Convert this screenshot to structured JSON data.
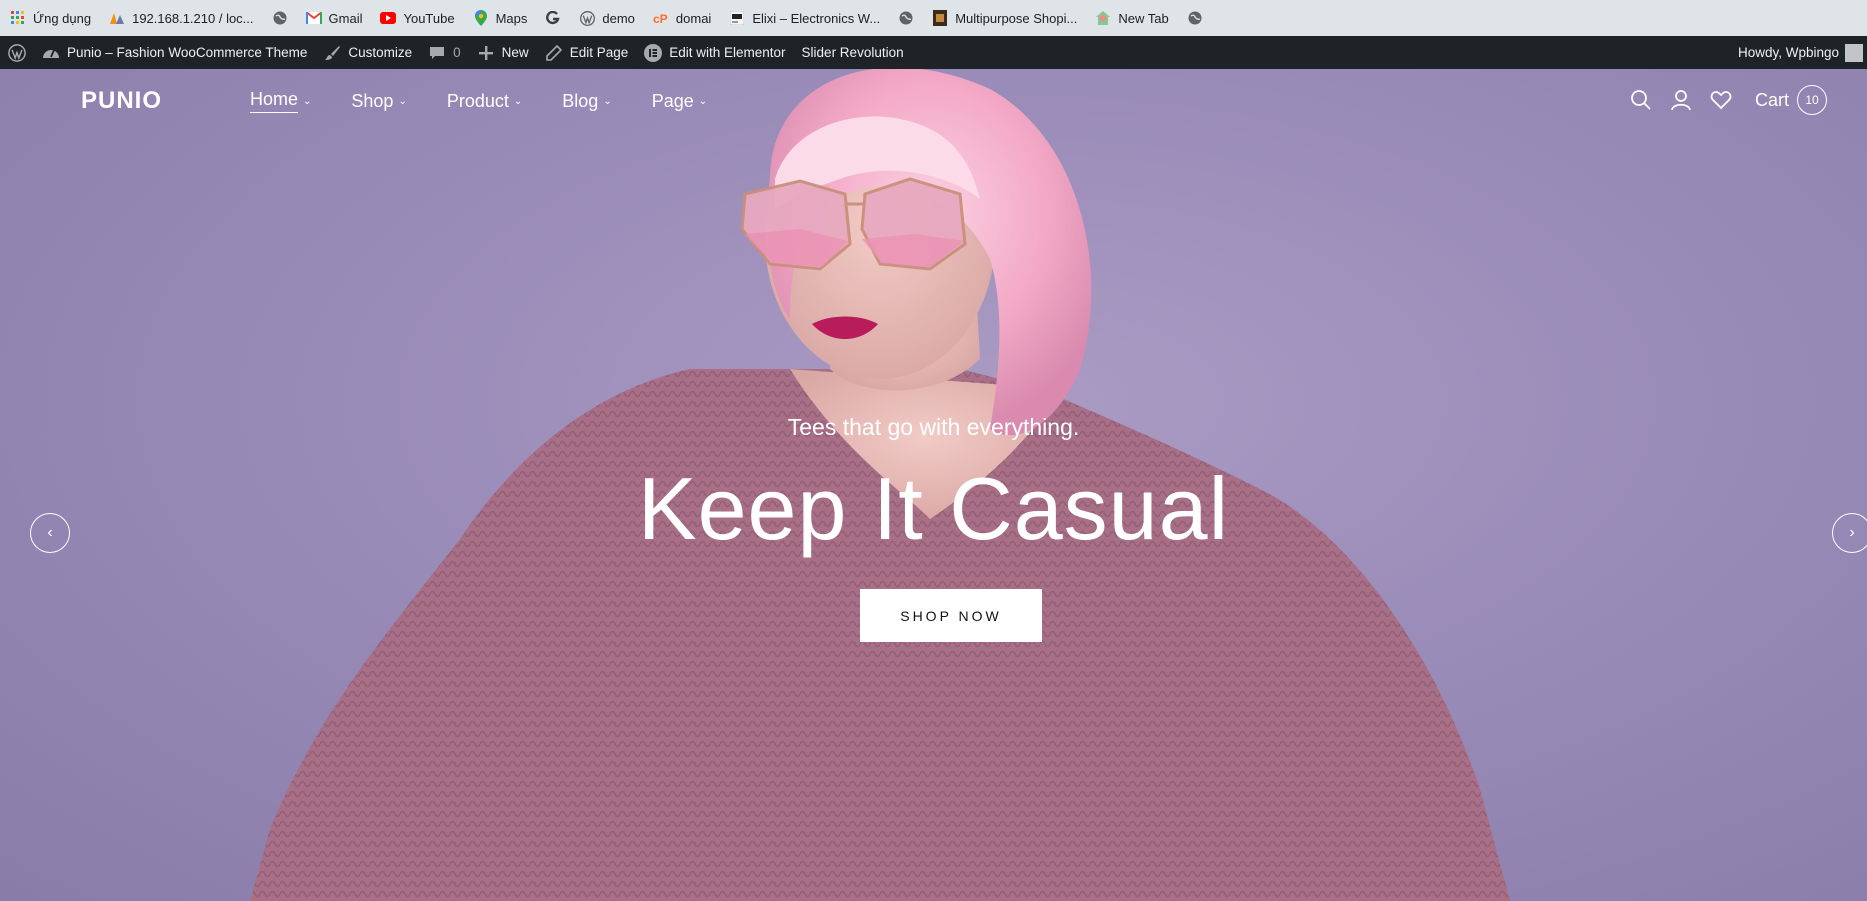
{
  "bookmarks": [
    {
      "label": "Ứng dụng",
      "icon": "apps-grid-icon"
    },
    {
      "label": "192.168.1.210 / loc...",
      "icon": "phpmyadmin-icon"
    },
    {
      "label": "",
      "icon": "globe-icon"
    },
    {
      "label": "Gmail",
      "icon": "gmail-icon"
    },
    {
      "label": "YouTube",
      "icon": "youtube-icon"
    },
    {
      "label": "Maps",
      "icon": "maps-pin-icon"
    },
    {
      "label": "",
      "icon": "opera-g-icon"
    },
    {
      "label": "demo",
      "icon": "wordpress-icon"
    },
    {
      "label": "domai",
      "icon": "cpanel-icon"
    },
    {
      "label": "Elixi – Electronics W...",
      "icon": "site-thumb-icon"
    },
    {
      "label": "",
      "icon": "globe-icon"
    },
    {
      "label": "Multipurpose Shopi...",
      "icon": "shop-thumb-icon"
    },
    {
      "label": "New Tab",
      "icon": "new-tab-icon"
    },
    {
      "label": "",
      "icon": "globe-icon"
    }
  ],
  "adminbar": {
    "site": "Punio – Fashion WooCommerce Theme",
    "customize": "Customize",
    "comments": "0",
    "new": "New",
    "edit_page": "Edit Page",
    "elementor": "Edit with Elementor",
    "slider": "Slider Revolution",
    "howdy": "Howdy, Wpbingo"
  },
  "header": {
    "logo": "PUNIO",
    "nav": [
      "Home",
      "Shop",
      "Product",
      "Blog",
      "Page"
    ],
    "cart_label": "Cart",
    "cart_count": "10"
  },
  "slide": {
    "tagline": "Tees that go with everything.",
    "headline": "Keep It Casual",
    "cta": "SHOP NOW",
    "prev": "‹",
    "next": "›"
  },
  "colors": {
    "admin_bg": "#1d2327",
    "bookmarks_bg": "#dfe4e8",
    "hero_bg": "#9a8cb8",
    "sweater": "#a86f86",
    "hair": "#f2a6c4"
  }
}
